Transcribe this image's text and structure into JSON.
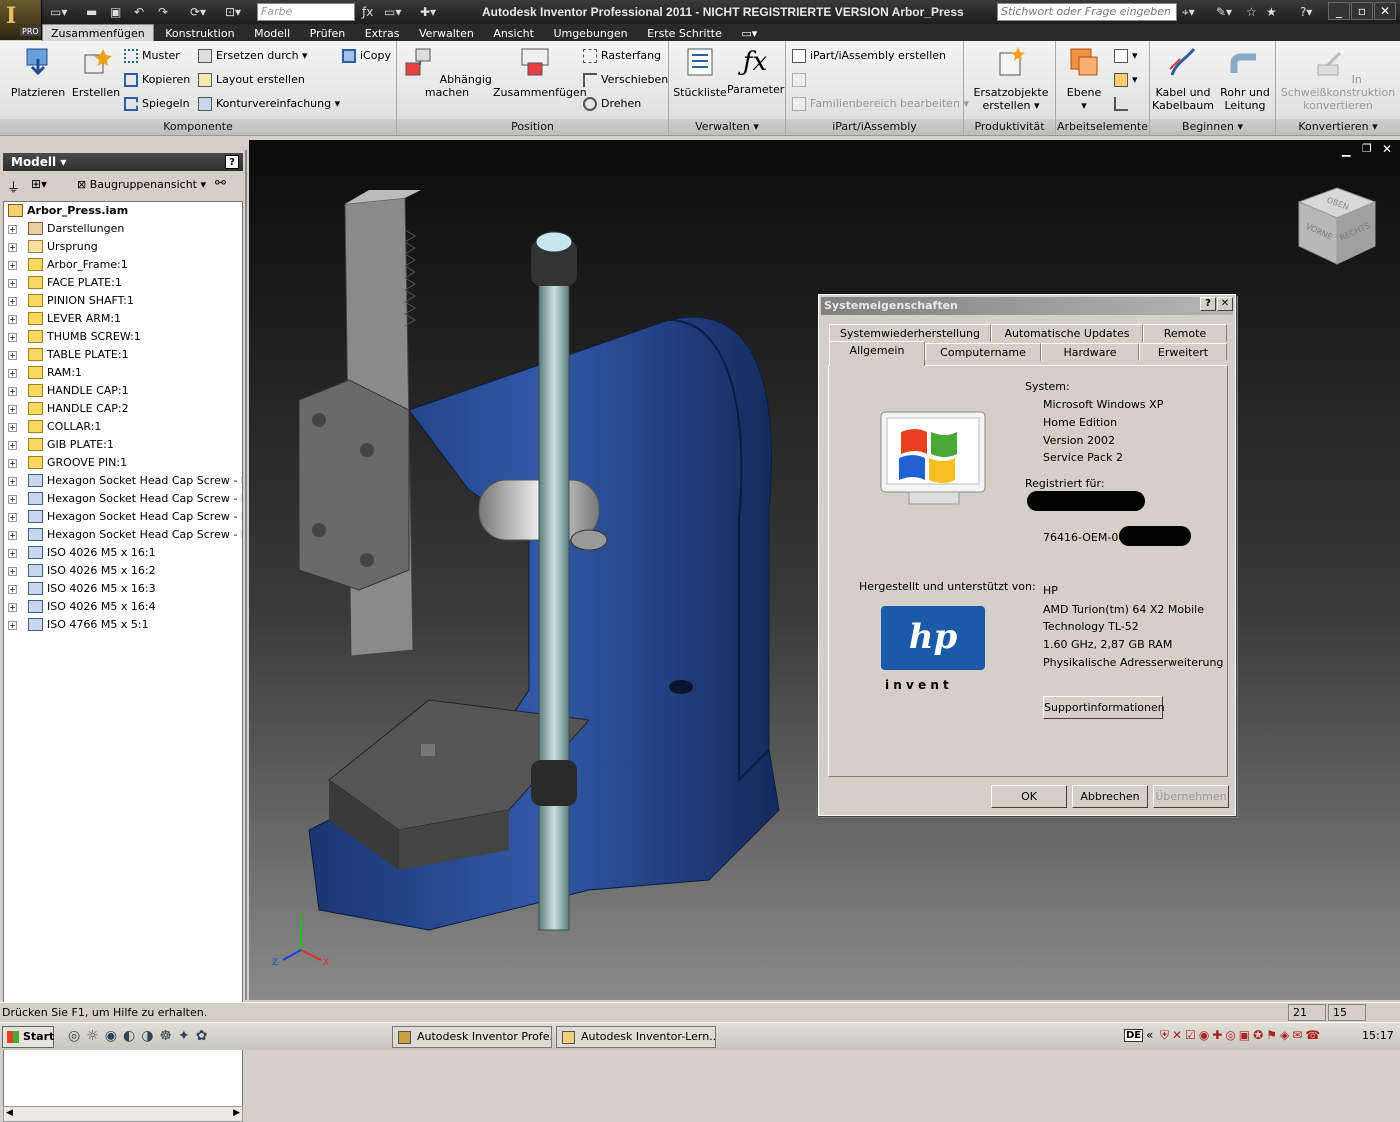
{
  "app": {
    "title": "Autodesk Inventor Professional 2011 - NICHT REGISTRIERTE VERSION   Arbor_Press",
    "logo_badge": "PRO",
    "color_field_placeholder": "Farbe",
    "help_search_placeholder": "Stichwort oder Frage eingeben"
  },
  "tabs": [
    "Zusammenfügen",
    "Konstruktion",
    "Modell",
    "Prüfen",
    "Extras",
    "Verwalten",
    "Ansicht",
    "Umgebungen",
    "Erste Schritte"
  ],
  "ribbon": {
    "komponente": {
      "label": "Komponente",
      "platzieren": "Platzieren",
      "erstellen": "Erstellen",
      "muster": "Muster",
      "kopieren": "Kopieren",
      "spiegeln": "Spiegeln",
      "ersetzen": "Ersetzen durch",
      "layout": "Layout erstellen",
      "kontur": "Konturvereinfachung",
      "icopy": "iCopy"
    },
    "position": {
      "label": "Position",
      "abhaengig": "Abhängig machen",
      "zusammenfuegen": "Zusammenfügen",
      "rasterfang": "Rasterfang",
      "verschieben": "Verschieben",
      "drehen": "Drehen"
    },
    "verwalten": {
      "label": "Verwalten",
      "stueckliste": "Stückliste",
      "parameter": "Parameter"
    },
    "ipart": {
      "label": "iPart/iAssembly",
      "erstellen": "iPart/iAssembly erstellen",
      "familien": "Familienbereich bearbeiten"
    },
    "produktivitaet": {
      "label": "Produktivität",
      "ersatz1": "Ersatzobjekte",
      "ersatz2": "erstellen"
    },
    "arbeitselemente": {
      "label": "Arbeitselemente",
      "ebene": "Ebene"
    },
    "beginnen": {
      "label": "Beginnen",
      "kabel1": "Kabel und",
      "kabel2": "Kabelbaum",
      "rohr1": "Rohr und",
      "rohr2": "Leitung"
    },
    "konvertieren": {
      "label": "Konvertieren",
      "schweiss1": "In Schweißkonstruktion",
      "schweiss2": "konvertieren"
    }
  },
  "browser": {
    "header": "Modell",
    "view_select": "Baugruppenansicht",
    "root": "Arbor_Press.iam",
    "items": [
      "Darstellungen",
      "Ursprung",
      "Arbor_Frame:1",
      "FACE PLATE:1",
      "PINION SHAFT:1",
      "LEVER ARM:1",
      "THUMB SCREW:1",
      "TABLE PLATE:1",
      "RAM:1",
      "HANDLE CAP:1",
      "HANDLE CAP:2",
      "COLLAR:1",
      "GIB PLATE:1",
      "GROOVE PIN:1",
      "Hexagon Socket Head Cap Screw - Inch",
      "Hexagon Socket Head Cap Screw - Inch",
      "Hexagon Socket Head Cap Screw - Inch",
      "Hexagon Socket Head Cap Screw - Inch",
      "ISO 4026 M5 x 16:1",
      "ISO 4026 M5 x 16:2",
      "ISO 4026 M5 x 16:3",
      "ISO 4026 M5 x 16:4",
      "ISO 4766 M5 x 5:1"
    ]
  },
  "viewcube": {
    "top": "OBEN",
    "front": "VORNE",
    "right": "RECHTS"
  },
  "axes": {
    "x": "X",
    "y": "Y",
    "z": "Z"
  },
  "dialog": {
    "title": "Systemeigenschaften",
    "tabs_row1": [
      "Systemwiederherstellung",
      "Automatische Updates",
      "Remote"
    ],
    "tabs_row2": [
      "Allgemein",
      "Computername",
      "Hardware",
      "Erweitert"
    ],
    "system_label": "System:",
    "system_lines": [
      "Microsoft Windows XP",
      "Home Edition",
      "Version 2002",
      "Service Pack 2"
    ],
    "registered_label": "Registriert für:",
    "product_id": "76416-OEM-00",
    "manufacturer_label": "Hergestellt und unterstützt von:",
    "manufacturer_lines": [
      "HP",
      "AMD Turion(tm) 64 X2 Mobile",
      "Technology TL-52",
      "1.60 GHz, 2,87 GB RAM",
      "Physikalische Adresserweiterung"
    ],
    "hp_logo": "hp",
    "hp_tagline": "i n v e n t",
    "support_button": "Supportinformationen",
    "ok": "OK",
    "cancel": "Abbrechen",
    "apply": "Übernehmen"
  },
  "status": {
    "help": "Drücken Sie F1, um Hilfe zu erhalten.",
    "n1": "21",
    "n2": "15"
  },
  "taskbar": {
    "start": "Start",
    "task1": "Autodesk Inventor Profe...",
    "task2": "Autodesk Inventor-Lern...",
    "lang": "DE",
    "clock": "15:17"
  },
  "colors": {
    "accent_blue": "#1f3f7a",
    "ribbon_dark": "#2a2a2a"
  }
}
